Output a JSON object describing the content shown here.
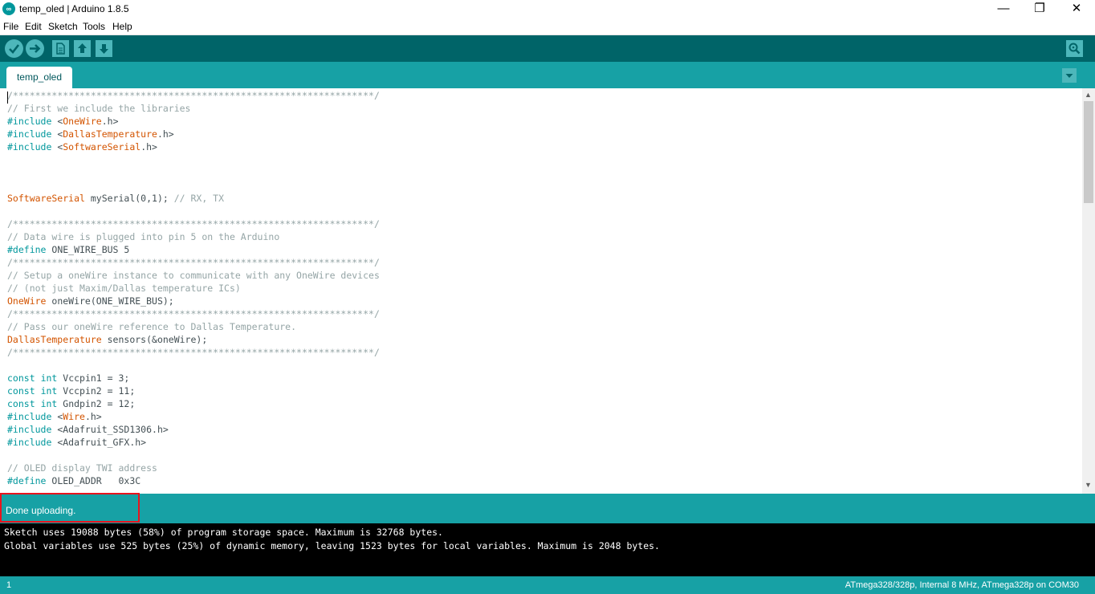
{
  "window": {
    "title": "temp_oled | Arduino 1.8.5",
    "minimize": "—",
    "maximize": "❐",
    "close": "✕"
  },
  "menu": [
    "File",
    "Edit",
    "Sketch",
    "Tools",
    "Help"
  ],
  "toolbar": {
    "verify_icon": "✓",
    "upload_icon": "→",
    "new_icon": "new-file-icon",
    "open_icon": "↑",
    "save_icon": "↓",
    "serial_icon": "magnifier-icon"
  },
  "tabs": [
    {
      "label": "temp_oled"
    }
  ],
  "tab_menu_icon": "▼",
  "editor": {
    "lines": [
      [
        [
          "c-com",
          "/*****************************************************************/"
        ]
      ],
      [
        [
          "c-com",
          "// First we include the libraries"
        ]
      ],
      [
        [
          "c-kw",
          "#include"
        ],
        [
          "c-plain",
          " <"
        ],
        [
          "c-type",
          "OneWire"
        ],
        [
          "c-plain",
          ".h>"
        ]
      ],
      [
        [
          "c-kw",
          "#include"
        ],
        [
          "c-plain",
          " <"
        ],
        [
          "c-type",
          "DallasTemperature"
        ],
        [
          "c-plain",
          ".h>"
        ]
      ],
      [
        [
          "c-kw",
          "#include"
        ],
        [
          "c-plain",
          " <"
        ],
        [
          "c-type",
          "SoftwareSerial"
        ],
        [
          "c-plain",
          ".h>"
        ]
      ],
      [],
      [],
      [],
      [
        [
          "c-type",
          "SoftwareSerial"
        ],
        [
          "c-plain",
          " mySerial(0,1); "
        ],
        [
          "c-com",
          "// RX, TX"
        ]
      ],
      [],
      [
        [
          "c-com",
          "/*****************************************************************/"
        ]
      ],
      [
        [
          "c-com",
          "// Data wire is plugged into pin 5 on the Arduino"
        ]
      ],
      [
        [
          "c-kw",
          "#define"
        ],
        [
          "c-plain",
          " ONE_WIRE_BUS 5"
        ]
      ],
      [
        [
          "c-com",
          "/*****************************************************************/"
        ]
      ],
      [
        [
          "c-com",
          "// Setup a oneWire instance to communicate with any OneWire devices"
        ]
      ],
      [
        [
          "c-com",
          "// (not just Maxim/Dallas temperature ICs)"
        ]
      ],
      [
        [
          "c-type",
          "OneWire"
        ],
        [
          "c-plain",
          " oneWire(ONE_WIRE_BUS);"
        ]
      ],
      [
        [
          "c-com",
          "/*****************************************************************/"
        ]
      ],
      [
        [
          "c-com",
          "// Pass our oneWire reference to Dallas Temperature."
        ]
      ],
      [
        [
          "c-type",
          "DallasTemperature"
        ],
        [
          "c-plain",
          " sensors(&oneWire);"
        ]
      ],
      [
        [
          "c-com",
          "/*****************************************************************/"
        ]
      ],
      [],
      [
        [
          "c-kw",
          "const"
        ],
        [
          "c-plain",
          " "
        ],
        [
          "c-kw",
          "int"
        ],
        [
          "c-plain",
          " Vccpin1 = 3;"
        ]
      ],
      [
        [
          "c-kw",
          "const"
        ],
        [
          "c-plain",
          " "
        ],
        [
          "c-kw",
          "int"
        ],
        [
          "c-plain",
          " Vccpin2 = 11;"
        ]
      ],
      [
        [
          "c-kw",
          "const"
        ],
        [
          "c-plain",
          " "
        ],
        [
          "c-kw",
          "int"
        ],
        [
          "c-plain",
          " Gndpin2 = 12;"
        ]
      ],
      [
        [
          "c-kw",
          "#include"
        ],
        [
          "c-plain",
          " <"
        ],
        [
          "c-type",
          "Wire"
        ],
        [
          "c-plain",
          ".h>"
        ]
      ],
      [
        [
          "c-kw",
          "#include"
        ],
        [
          "c-plain",
          " <Adafruit_SSD1306.h>"
        ]
      ],
      [
        [
          "c-kw",
          "#include"
        ],
        [
          "c-plain",
          " <Adafruit_GFX.h>"
        ]
      ],
      [],
      [
        [
          "c-com",
          "// OLED display TWI address"
        ]
      ],
      [
        [
          "c-kw",
          "#define"
        ],
        [
          "c-plain",
          " OLED_ADDR   0x3C"
        ]
      ]
    ]
  },
  "status": {
    "message": "Done uploading."
  },
  "console": {
    "lines": [
      "Sketch uses 19088 bytes (58%) of program storage space. Maximum is 32768 bytes.",
      "Global variables use 525 bytes (25%) of dynamic memory, leaving 1523 bytes for local variables. Maximum is 2048 bytes."
    ]
  },
  "footer": {
    "line_number": "1",
    "board": "ATmega328/328p, Internal 8 MHz, ATmega328p on COM30"
  }
}
